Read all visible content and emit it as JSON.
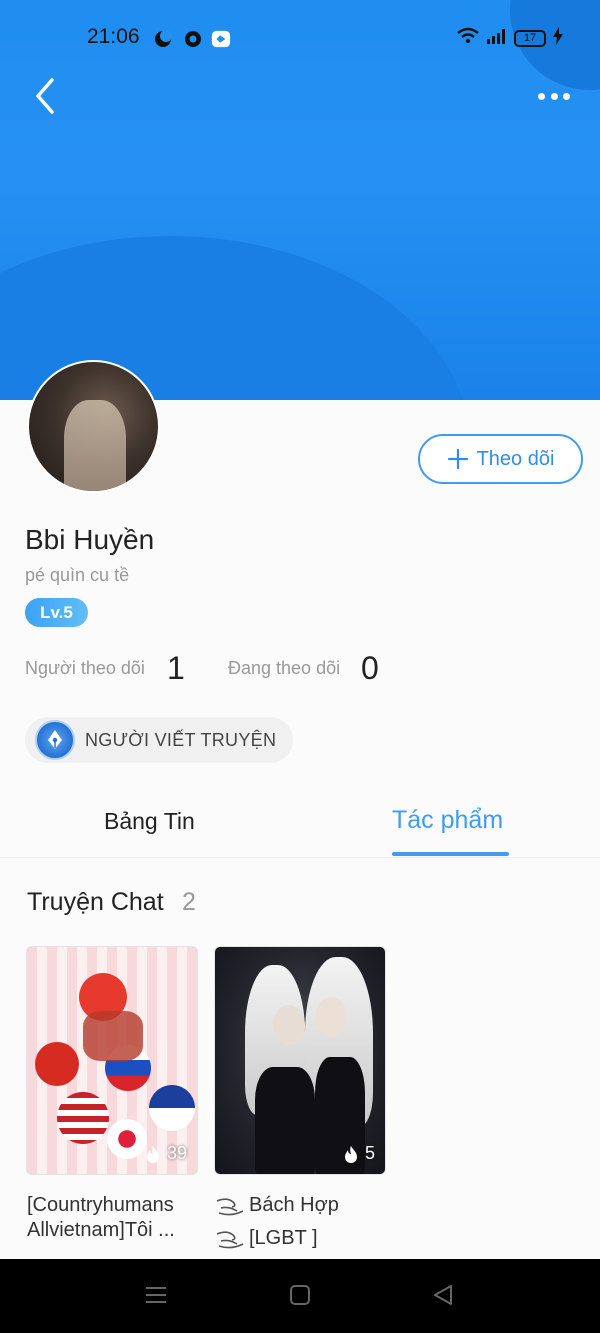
{
  "status_bar": {
    "time": "21:06",
    "battery": "17",
    "notification_icons": [
      "moon-icon",
      "chrome-icon",
      "app-icon"
    ],
    "system_icons": [
      "wifi-icon",
      "signal-icon",
      "battery-icon",
      "charging-icon"
    ]
  },
  "profile": {
    "name": "Bbi Huyền",
    "bio": "pé quìn cu tề",
    "level": "Lv.5",
    "follow_button": "Theo dõi",
    "followers_label": "Người theo dõi",
    "followers_count": "1",
    "following_label": "Đang theo dõi",
    "following_count": "0",
    "badge": "NGƯỜI VIẾT TRUYỆN"
  },
  "tabs": [
    {
      "label": "Bảng Tin",
      "active": false
    },
    {
      "label": "Tác phẩm",
      "active": true
    }
  ],
  "section": {
    "title": "Truyện Chat",
    "count": "2"
  },
  "stories": [
    {
      "title_line1": "[Countryhumans",
      "title_line2": "Allvietnam]Tôi ...",
      "views": "39"
    },
    {
      "title_line1": "Bách Hợp",
      "title_line2": "[LGBT ]",
      "views": "5"
    }
  ],
  "colors": {
    "header_blue": "#1f8ef0",
    "accent": "#3f9cf0"
  }
}
